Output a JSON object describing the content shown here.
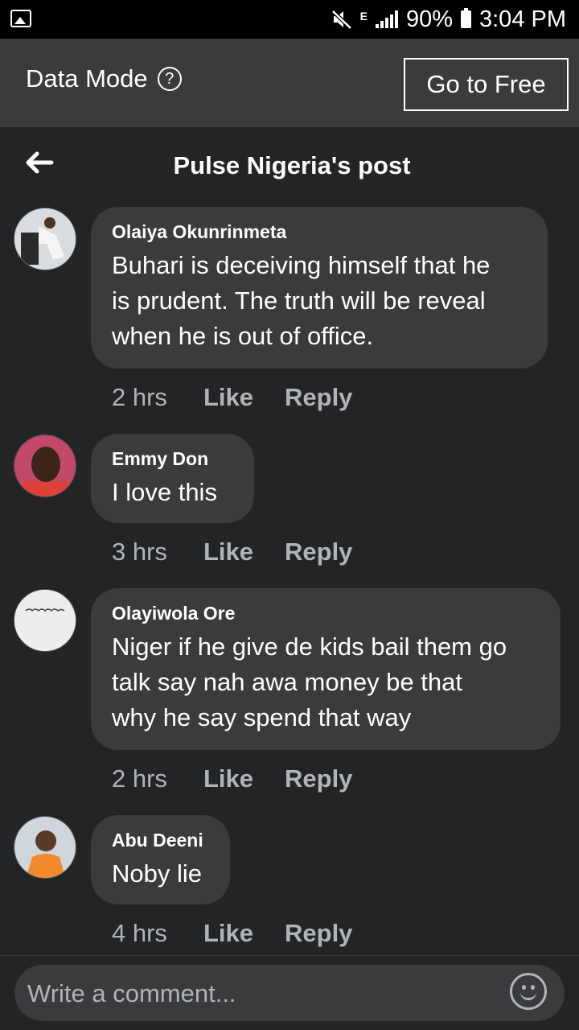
{
  "status_bar": {
    "battery": "90%",
    "time": "3:04 PM",
    "network": "E"
  },
  "data_mode": {
    "label": "Data Mode",
    "help": "?",
    "go_free": "Go to Free"
  },
  "header": {
    "title": "Pulse Nigeria's post"
  },
  "comments": [
    {
      "author": "Olaiya Okunrinmeta",
      "lines": [
        "Buhari is deceiving himself that he",
        "is prudent. The truth will be reveal",
        "when he is out of office."
      ],
      "time": "2 hrs",
      "like": "Like",
      "reply": "Reply"
    },
    {
      "author": "Emmy Don",
      "lines": [
        "I love this"
      ],
      "time": "3 hrs",
      "like": "Like",
      "reply": "Reply"
    },
    {
      "author": "Olayiwola Ore",
      "lines": [
        "Niger if he give de kids bail them go",
        "talk say nah awa money be that",
        "why he say spend that way"
      ],
      "time": "2 hrs",
      "like": "Like",
      "reply": "Reply"
    },
    {
      "author": "Abu Deeni",
      "lines": [
        "Noby lie"
      ],
      "time": "4 hrs",
      "like": "Like",
      "reply": "Reply"
    }
  ],
  "composer": {
    "placeholder": "Write a comment..."
  }
}
